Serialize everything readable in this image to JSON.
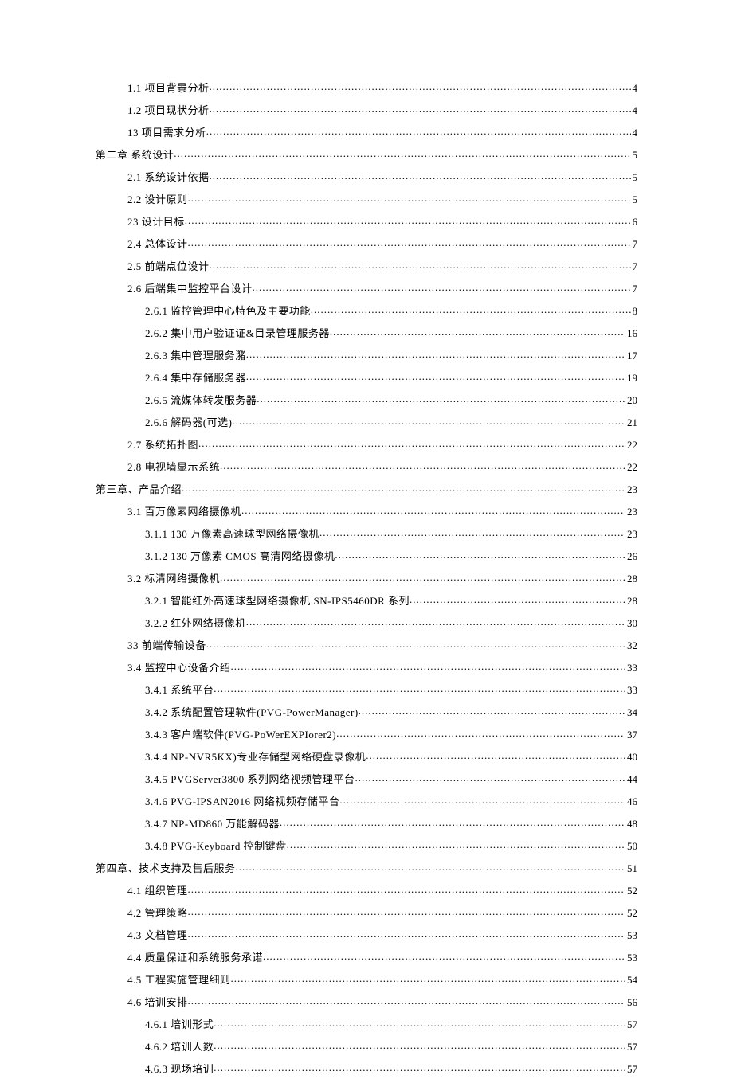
{
  "toc": [
    {
      "indent": 1,
      "num": "1.1",
      "title": "项目背景分析",
      "page": "4"
    },
    {
      "indent": 1,
      "num": "1.2",
      "title": "项目现状分析",
      "page": "4"
    },
    {
      "indent": 1,
      "num": "13",
      "title": "项目需求分析",
      "page": "4",
      "tight": true
    },
    {
      "indent": 0,
      "num": "第二章",
      "title": "系统设计",
      "page": "5",
      "tight": true
    },
    {
      "indent": 1,
      "num": "2.1",
      "title": "系统设计依据",
      "page": "5"
    },
    {
      "indent": 1,
      "num": "2.2",
      "title": "设计原则",
      "page": "5"
    },
    {
      "indent": 1,
      "num": "23",
      "title": "设计目标",
      "page": "6",
      "tight": true
    },
    {
      "indent": 1,
      "num": "2.4",
      "title": "总体设计",
      "page": "7"
    },
    {
      "indent": 1,
      "num": "2.5",
      "title": "前端点位设计",
      "page": "7"
    },
    {
      "indent": 1,
      "num": "2.6",
      "title": "后端集中监控平台设计",
      "page": "7"
    },
    {
      "indent": 2,
      "num": "2.6.1",
      "title": "监控管理中心特色及主要功能",
      "page": "8"
    },
    {
      "indent": 2,
      "num": "2.6.2",
      "title": "集中用户验证证&目录管理服务器",
      "page": "16"
    },
    {
      "indent": 2,
      "num": "2.6.3",
      "title": "集中管理服务潴",
      "page": "17"
    },
    {
      "indent": 2,
      "num": "2.6.4",
      "title": "集中存储服务器",
      "page": "19"
    },
    {
      "indent": 2,
      "num": "2.6.5",
      "title": "流媒体转发服务器",
      "page": "20"
    },
    {
      "indent": 2,
      "num": "2.6.6",
      "title": "解码器(可选)",
      "page": "21"
    },
    {
      "indent": 1,
      "num": "2.7",
      "title": "系统拓扑图",
      "page": "22"
    },
    {
      "indent": 1,
      "num": "2.8",
      "title": "电视墙显示系统",
      "page": "22"
    },
    {
      "indent": 0,
      "num": "第三章、产品介绍",
      "title": "",
      "page": "23",
      "tight": true
    },
    {
      "indent": 1,
      "num": "3.1",
      "title": "百万像素网络摄像机",
      "page": "23"
    },
    {
      "indent": 2,
      "num": "3.1.1",
      "title": "130 万像素高速球型网络摄像机",
      "page": "23"
    },
    {
      "indent": 2,
      "num": "3.1.2",
      "title": "130 万像素 CMOS 高清网络摄像机",
      "page": "26"
    },
    {
      "indent": 1,
      "num": "3.2",
      "title": "标清网络摄像机",
      "page": "28"
    },
    {
      "indent": 2,
      "num": "3.2.1",
      "title": "智能红外高速球型网络摄像机 SN-IPS5460DR 系列",
      "page": "28"
    },
    {
      "indent": 2,
      "num": "3.2.2",
      "title": "红外网络摄像机",
      "page": "30"
    },
    {
      "indent": 1,
      "num": "33",
      "title": "前端传输设备",
      "page": "32",
      "tight": true
    },
    {
      "indent": 1,
      "num": "3.4",
      "title": "监控中心设备介绍",
      "page": "33",
      "tight": true
    },
    {
      "indent": 2,
      "num": "3.4.1",
      "title": "系统平台",
      "page": "33"
    },
    {
      "indent": 2,
      "num": "3.4.2",
      "title": "系统配置管理软件(PVG-PowerManager)",
      "page": "34"
    },
    {
      "indent": 2,
      "num": "3.4.3",
      "title": "客户端软件(PVG-PoWerEXPIorer2)",
      "page": "37",
      "fine": true
    },
    {
      "indent": 2,
      "num": "3.4.4",
      "title": "NP-NVR5KX)专业存储型网络硬盘录像机",
      "page": "40"
    },
    {
      "indent": 2,
      "num": "3.4.5",
      "title": "PVGServer3800 系列网络视频管理平台",
      "page": "44"
    },
    {
      "indent": 2,
      "num": "3.4.6",
      "title": "PVG-IPSAN2016 网络视频存储平台",
      "page": "46"
    },
    {
      "indent": 2,
      "num": "3.4.7",
      "title": "NP-MD860 万能解码器",
      "page": "48"
    },
    {
      "indent": 2,
      "num": "3.4.8",
      "title": "PVG-Keyboard 控制键盘",
      "page": "50"
    },
    {
      "indent": 0,
      "num": "第四章、技术支持及售后服务",
      "title": "",
      "page": "51",
      "tight": true
    },
    {
      "indent": 1,
      "num": "4.1",
      "title": "组织管理",
      "page": "52"
    },
    {
      "indent": 1,
      "num": "4.2",
      "title": "管理策略",
      "page": "52"
    },
    {
      "indent": 1,
      "num": "4.3",
      "title": "文档管理",
      "page": "53"
    },
    {
      "indent": 1,
      "num": "4.4",
      "title": "质量保证和系统服务承诺",
      "page": "53"
    },
    {
      "indent": 1,
      "num": "4.5",
      "title": "工程实施管理细则",
      "page": "54"
    },
    {
      "indent": 1,
      "num": "4.6",
      "title": "培训安排",
      "page": "56"
    },
    {
      "indent": 2,
      "num": "4.6.1",
      "title": "培训形式",
      "page": "57"
    },
    {
      "indent": 2,
      "num": "4.6.2",
      "title": "培训人数",
      "page": "57"
    },
    {
      "indent": 2,
      "num": "4.6.3",
      "title": "现场培训",
      "page": "57"
    }
  ]
}
